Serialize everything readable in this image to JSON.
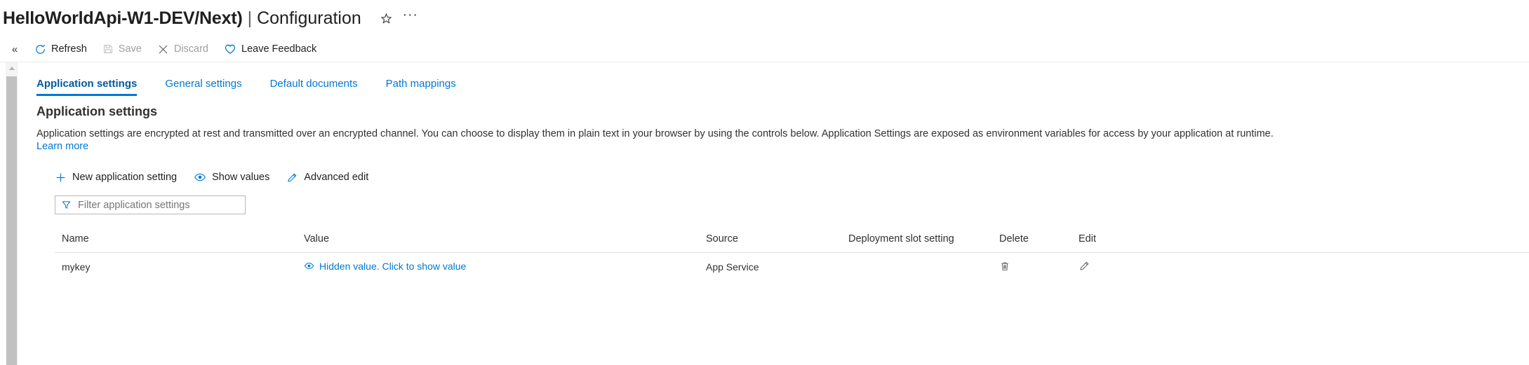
{
  "header": {
    "title": "HelloWorldApi-W1-DEV/Next)",
    "separator": "|",
    "subtitle": "Configuration",
    "favorite_icon": "star-icon",
    "more_icon": "ellipsis-icon",
    "more_label": "···"
  },
  "toolbar": {
    "collapse_label": "«",
    "items": [
      {
        "label": "Refresh",
        "icon": "refresh-icon",
        "disabled": false
      },
      {
        "label": "Save",
        "icon": "save-icon",
        "disabled": true
      },
      {
        "label": "Discard",
        "icon": "discard-icon",
        "disabled": true
      },
      {
        "label": "Leave Feedback",
        "icon": "heart-icon",
        "disabled": false
      }
    ]
  },
  "tabs": [
    {
      "label": "Application settings",
      "active": true
    },
    {
      "label": "General settings",
      "active": false
    },
    {
      "label": "Default documents",
      "active": false
    },
    {
      "label": "Path mappings",
      "active": false
    }
  ],
  "main": {
    "section_title": "Application settings",
    "description": "Application settings are encrypted at rest and transmitted over an encrypted channel. You can choose to display them in plain text in your browser by using the controls below. Application Settings are exposed as environment variables for access by your application at runtime.",
    "learn_more": "Learn more"
  },
  "commands": [
    {
      "label": "New application setting",
      "icon": "plus-icon"
    },
    {
      "label": "Show values",
      "icon": "eye-icon"
    },
    {
      "label": "Advanced edit",
      "icon": "pencil-icon"
    }
  ],
  "filter": {
    "placeholder": "Filter application settings",
    "value": "",
    "icon": "filter-icon"
  },
  "table": {
    "columns": [
      "Name",
      "Value",
      "Source",
      "Deployment slot setting",
      "Delete",
      "Edit"
    ],
    "rows": [
      {
        "name": "mykey",
        "value_label": "Hidden value. Click to show value",
        "value_icon": "eye-icon",
        "source": "App Service",
        "slot_setting": "",
        "delete_icon": "trash-icon",
        "edit_icon": "pencil-icon"
      }
    ]
  },
  "colors": {
    "accent": "#0078d4",
    "accent_dark": "#005a9e",
    "text": "#323130",
    "disabled": "#a19f9d"
  }
}
